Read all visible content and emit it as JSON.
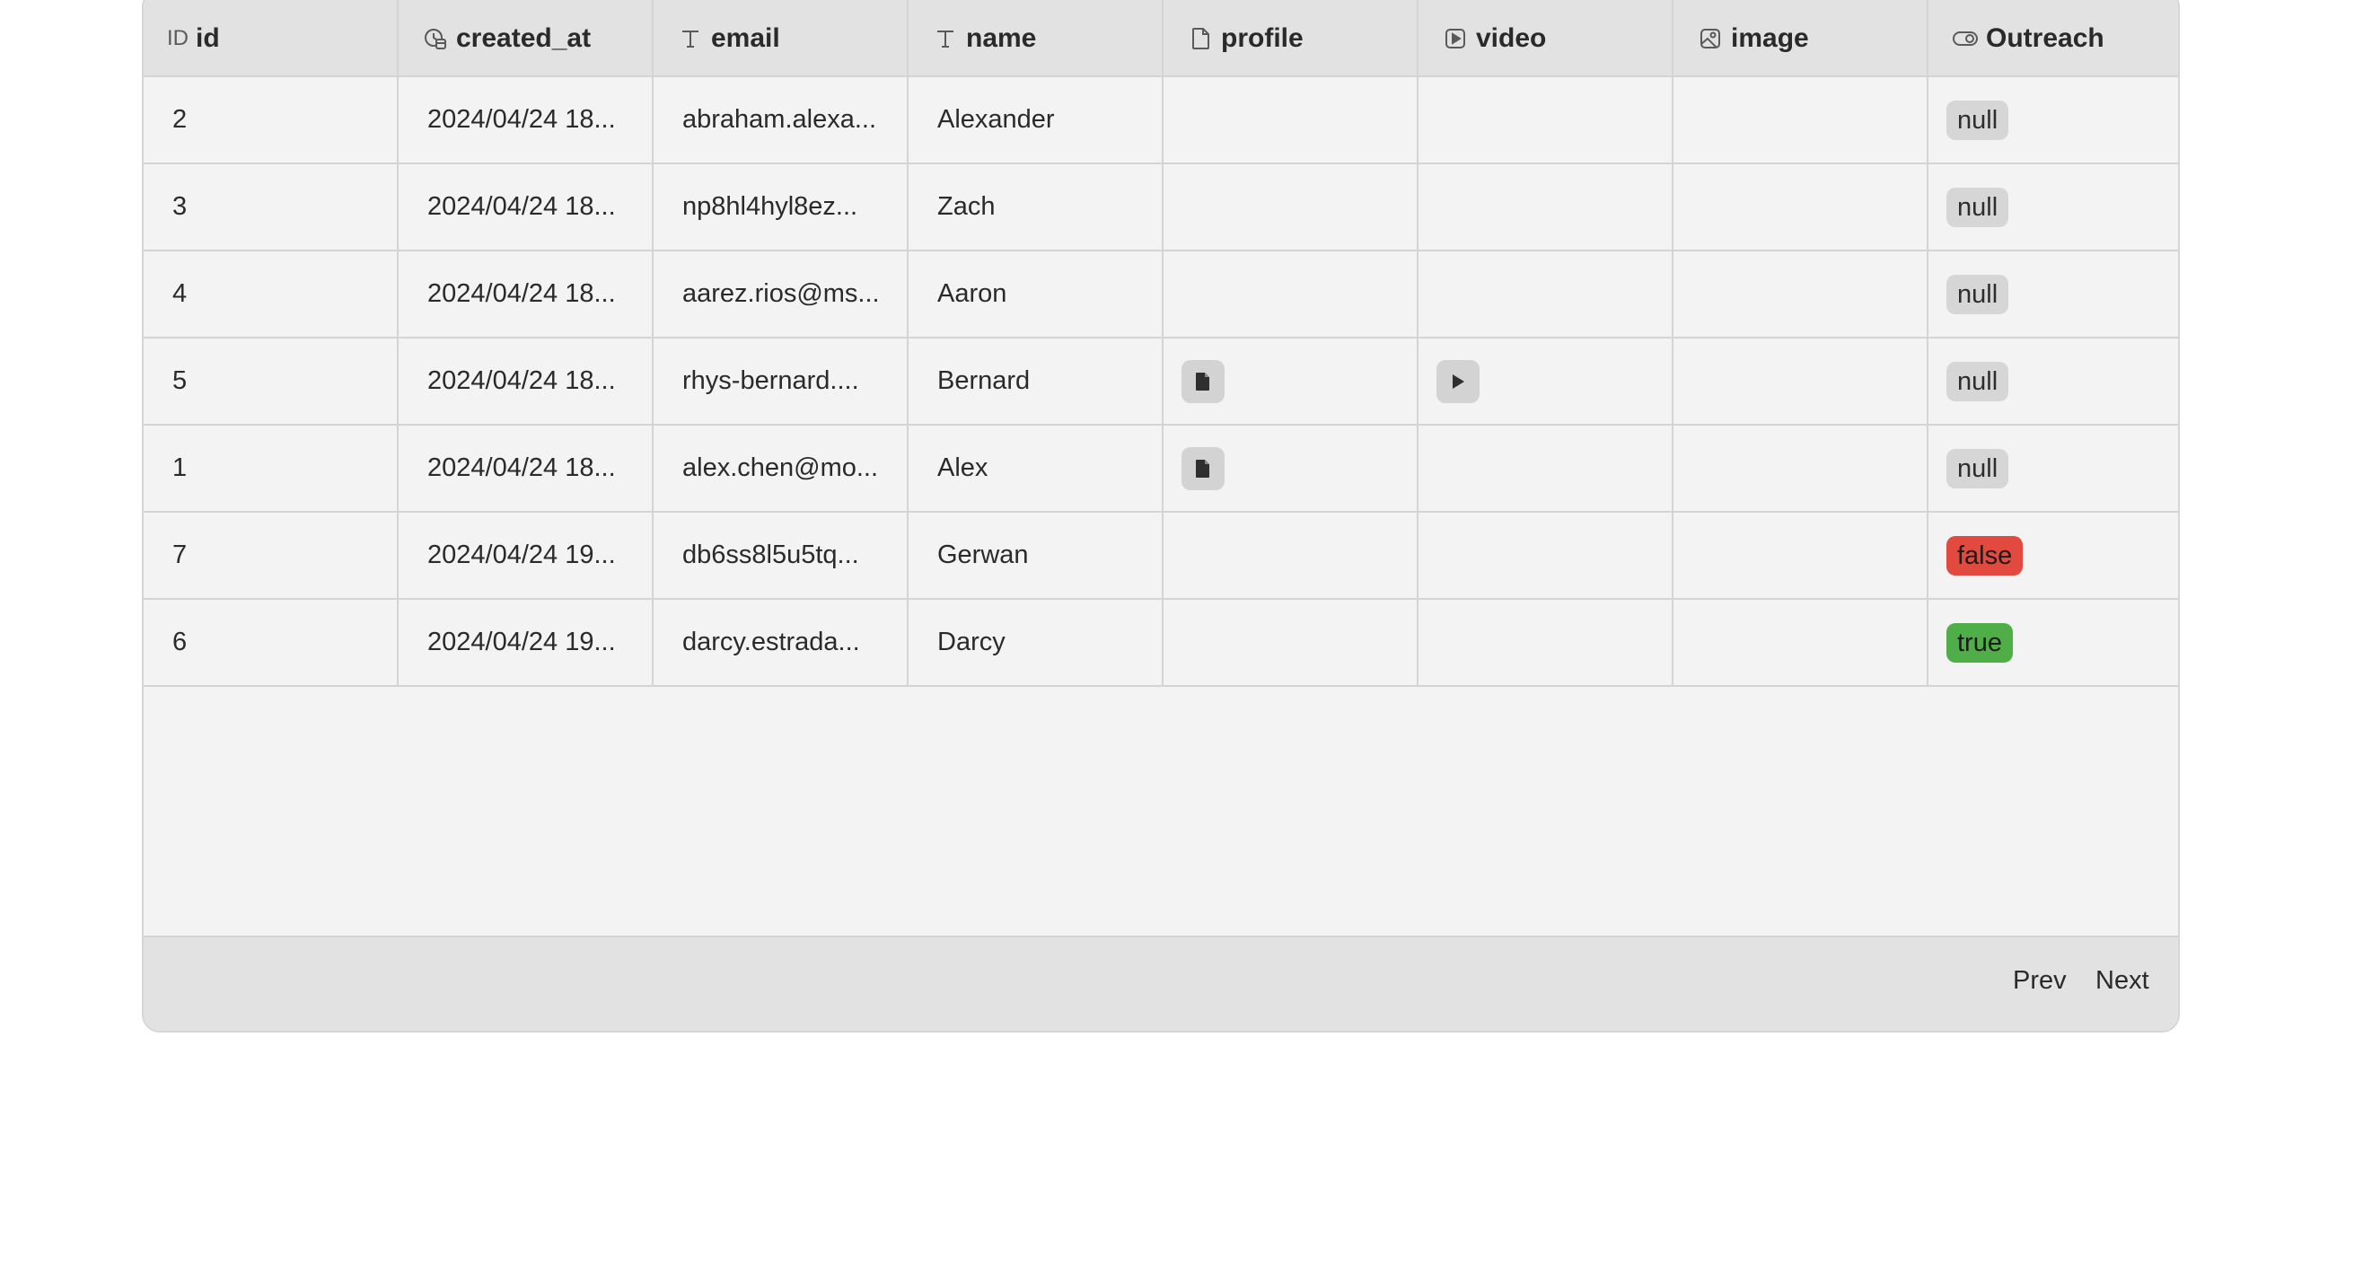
{
  "columns": [
    {
      "label": "id",
      "icon": "id-icon"
    },
    {
      "label": "created_at",
      "icon": "clock-calendar-icon"
    },
    {
      "label": "email",
      "icon": "text-icon"
    },
    {
      "label": "name",
      "icon": "text-icon"
    },
    {
      "label": "profile",
      "icon": "file-icon"
    },
    {
      "label": "video",
      "icon": "video-icon"
    },
    {
      "label": "image",
      "icon": "image-icon"
    },
    {
      "label": "Outreach",
      "icon": "toggle-icon"
    }
  ],
  "header_icon_text": {
    "id": "ID"
  },
  "rows": [
    {
      "id": "2",
      "created_at": "2024/04/24 18...",
      "email": "abraham.alexa...",
      "name": "Alexander",
      "profile": false,
      "video": false,
      "outreach": "null"
    },
    {
      "id": "3",
      "created_at": "2024/04/24 18...",
      "email": "np8hl4hyl8ez...",
      "name": "Zach",
      "profile": false,
      "video": false,
      "outreach": "null"
    },
    {
      "id": "4",
      "created_at": "2024/04/24 18...",
      "email": "aarez.rios@ms...",
      "name": "Aaron",
      "profile": false,
      "video": false,
      "outreach": "null"
    },
    {
      "id": "5",
      "created_at": "2024/04/24 18...",
      "email": "rhys-bernard....",
      "name": "Bernard",
      "profile": true,
      "video": true,
      "outreach": "null"
    },
    {
      "id": "1",
      "created_at": "2024/04/24 18...",
      "email": "alex.chen@mo...",
      "name": "Alex",
      "profile": true,
      "video": false,
      "outreach": "null"
    },
    {
      "id": "7",
      "created_at": "2024/04/24 19...",
      "email": "db6ss8l5u5tq...",
      "name": "Gerwan",
      "profile": false,
      "video": false,
      "outreach": "false"
    },
    {
      "id": "6",
      "created_at": "2024/04/24 19...",
      "email": "darcy.estrada...",
      "name": "Darcy",
      "profile": false,
      "video": false,
      "outreach": "true"
    }
  ],
  "footer": {
    "prev_label": "Prev",
    "next_label": "Next"
  },
  "colors": {
    "false_tag": "#e24a3f",
    "true_tag": "#4fae47",
    "null_tag": "#d6d6d6"
  }
}
